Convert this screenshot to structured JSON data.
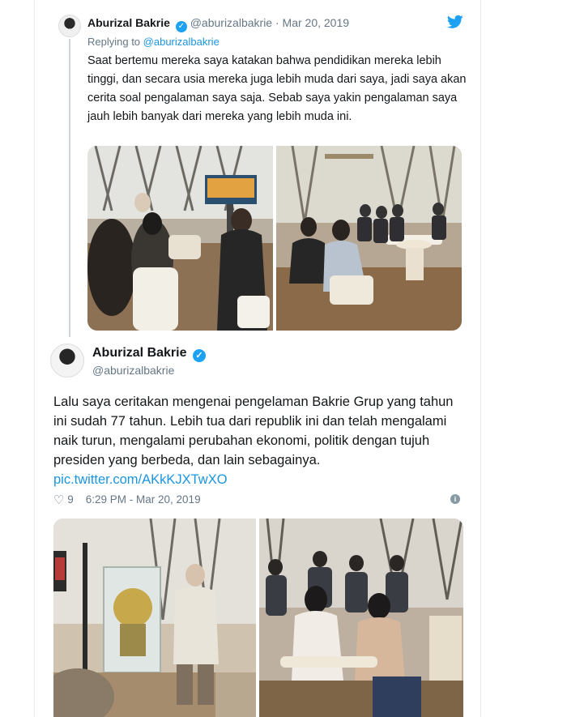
{
  "reply_tweet": {
    "author_name": "Aburizal Bakrie",
    "handle": "@aburizalbakrie",
    "separator": "·",
    "date": "Mar 20, 2019",
    "replying_to_label": "Replying to",
    "replying_to_handle": "@aburizalbakrie",
    "text": "Saat bertemu mereka saya katakan bahwa pendidikan mereka lebih tinggi, dan secara usia mereka juga lebih muda dari saya, jadi saya akan cerita soal pengalaman saya saja. Sebab saya yakin pengalaman saya jauh lebih banyak dari mereka yang lebih muda ini."
  },
  "main_tweet": {
    "author_name": "Aburizal Bakrie",
    "handle": "@aburizalbakrie",
    "text": "Lalu saya ceritakan mengenai pengelaman Bakrie Grup yang tahun ini sudah 77 tahun. Lebih tua dari republik ini dan telah mengalami naik turun, mengalami perubahan  ekonomi, politik dengan tujuh presiden yang berbeda, dan lain sebagainya.",
    "link": "pic.twitter.com/AKkKJXTwXO",
    "likes": "9",
    "timestamp": "6:29 PM - Mar 20, 2019"
  },
  "icons": {
    "verified": "verified-badge-icon",
    "brand": "twitter-bird-icon",
    "like": "heart-icon",
    "info": "info-icon"
  },
  "colors": {
    "accent": "#1da1f2",
    "link": "#1b95e0",
    "muted": "#657786",
    "text": "#14171a"
  }
}
